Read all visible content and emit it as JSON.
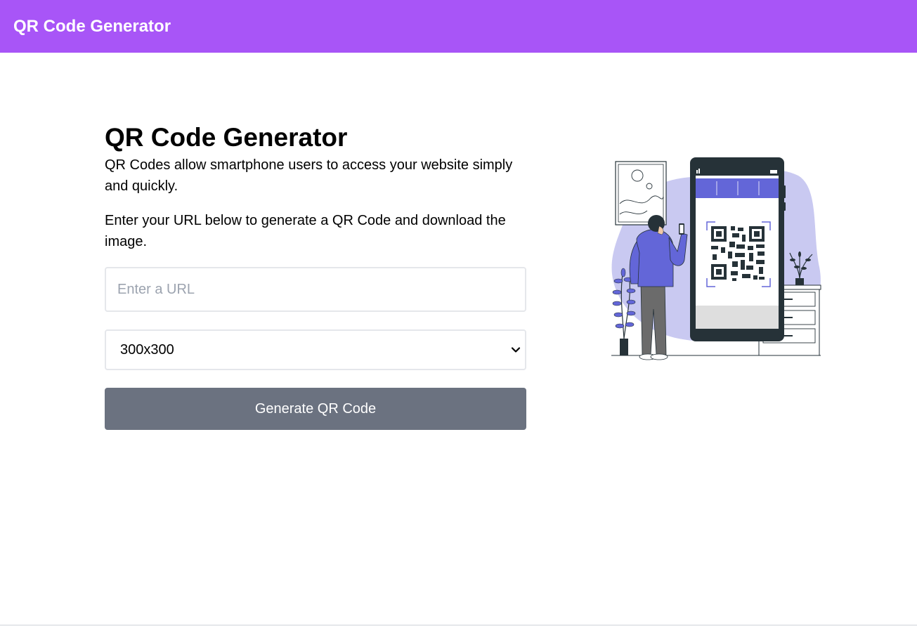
{
  "header": {
    "brand": "QR Code Generator"
  },
  "main": {
    "title": "QR Code Generator",
    "paragraph_1": "QR Codes allow smartphone users to access your website simply and quickly.",
    "paragraph_2": "Enter your URL below to generate a QR Code and download the image.",
    "url_input": {
      "placeholder": "Enter a URL",
      "value": ""
    },
    "size_select": {
      "selected": "300x300"
    },
    "generate_button": "Generate QR Code"
  },
  "illustration": {
    "icon": "person-scanning-qr-illustration"
  },
  "colors": {
    "header_bg": "#a855f7",
    "button_bg": "#6b7280",
    "illustration_accent": "#6366d8",
    "illustration_blob": "#c9c9f1",
    "illustration_dark": "#263238"
  }
}
